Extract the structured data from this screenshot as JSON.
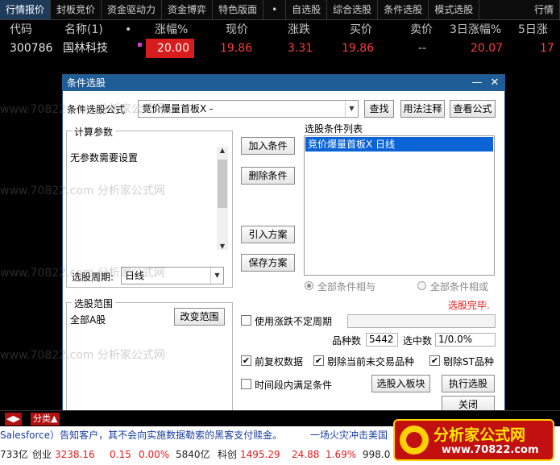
{
  "tabs": [
    "行情报价",
    "封板竞价",
    "资金驱动力",
    "资金博弈",
    "特色版面",
    "自选股",
    "综合选股",
    "条件选股",
    "模式选股",
    "行情"
  ],
  "tab_dot": "•",
  "quote_header": {
    "code": "代码",
    "name": "名称(1)",
    "dot": "•",
    "change_pct": "涨幅%",
    "price": "现价",
    "change": "涨跌",
    "bid": "买价",
    "ask": "卖价",
    "pct3d": "3日涨幅%",
    "pct5d": "5日涨"
  },
  "quote_row": {
    "code": "300786",
    "name": "国林科技",
    "change_pct": "20.00",
    "price": "19.86",
    "change": "3.31",
    "bid": "19.86",
    "ask": "--",
    "pct3d": "20.07",
    "pct5d": "17"
  },
  "watermark": "www.70822.com 分析家公式网",
  "dialog": {
    "title": "条件选股",
    "min_icon": "—",
    "close_icon": "✕",
    "formula_label": "条件选股公式",
    "formula_value": "竞价爆量首板X  -",
    "find_btn": "查找",
    "usage_btn": "用法注释",
    "view_btn": "查看公式",
    "params_title": "计算参数",
    "params_text": "无参数需要设置",
    "period_label": "选股周期:",
    "period_value": "日线",
    "add_btn": "加入条件",
    "del_btn": "删除条件",
    "import_btn": "引入方案",
    "save_btn": "保存方案",
    "list_title": "选股条件列表",
    "list_items": [
      "竞价爆量首板X  日线"
    ],
    "radio_and": "全部条件相与",
    "radio_or": "全部条件相或",
    "status": "选股完毕.",
    "range_title": "选股范围",
    "range_text": "全部A股",
    "range_btn": "改变范围",
    "uncertain_label": "使用涨跌不定周期",
    "count_label": "品种数",
    "count_value": "5442",
    "selected_label": "选中数",
    "selected_value": "1/0.0%",
    "cb_restore": "前复权数据",
    "cb_exclude_untraded": "剔除当前未交易品种",
    "cb_exclude_st": "剔除ST品种",
    "cb_timerange": "时间段内满足条件",
    "to_board_btn": "选股入板块",
    "run_btn": "执行选股",
    "close_btn": "关闭",
    "check_mark": "✔"
  },
  "bottom": {
    "arrows": "◀▶",
    "fenlei": "分类▲"
  },
  "news": {
    "left": "Salesforce）告知客户，其不会向实施数据勒索的黑客支付赎金。",
    "right": "一场火灾冲击美国"
  },
  "ticker": {
    "a": "733亿",
    "b_label": "创业",
    "b_value": "3238.16",
    "c": "0.15",
    "d": "0.00%",
    "e": "5840亿",
    "f_label": "科创",
    "f_value": "1495.29",
    "g": "24.88",
    "h": "1.69%",
    "i": "998.0"
  },
  "logo": {
    "title": "分析家公式网",
    "url": "www.70822.com"
  }
}
